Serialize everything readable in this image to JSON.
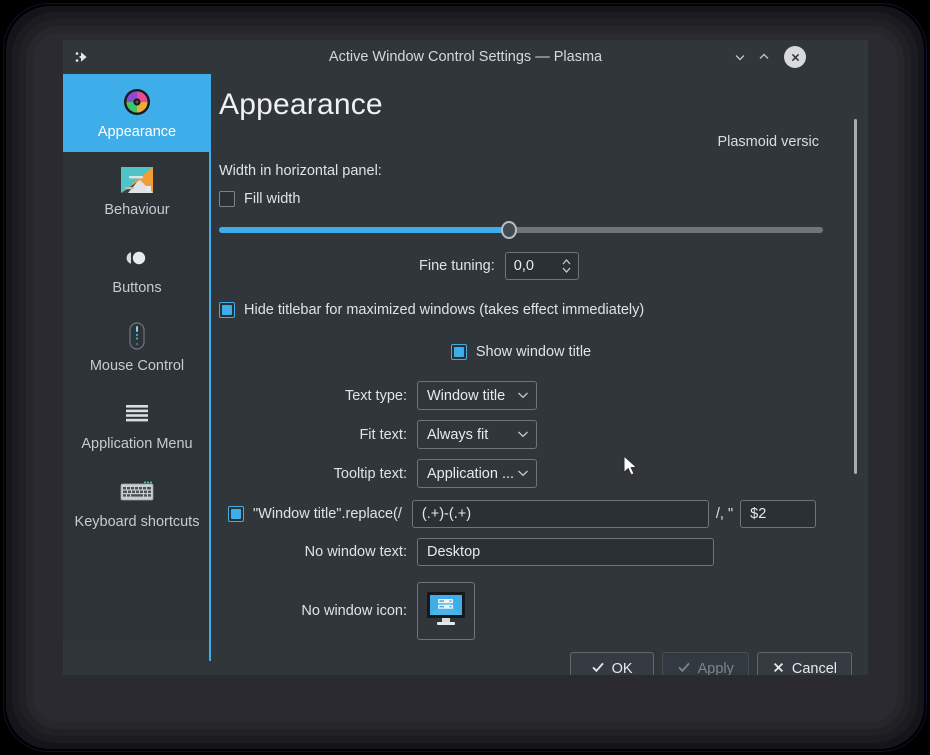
{
  "window": {
    "title": "Active Window Control Settings — Plasma",
    "app_icon": "plasma-dots-icon",
    "minimize_label": "Minimize",
    "maximize_label": "Maximize",
    "close_label": "Close"
  },
  "sidebar": {
    "items": [
      {
        "label": "Appearance",
        "icon": "color-wheel-icon",
        "active": true
      },
      {
        "label": "Behaviour",
        "icon": "desktop-behaviour-icon",
        "active": false
      },
      {
        "label": "Buttons",
        "icon": "window-buttons-icon",
        "active": false
      },
      {
        "label": "Mouse Control",
        "icon": "mouse-icon",
        "active": false
      },
      {
        "label": "Application Menu",
        "icon": "hamburger-menu-icon",
        "active": false
      },
      {
        "label": "Keyboard shortcuts",
        "icon": "keyboard-icon",
        "active": false
      }
    ]
  },
  "main": {
    "page_title": "Appearance",
    "plasmoid_version": "Plasmoid versic",
    "width_section_label": "Width in horizontal panel:",
    "fill_width": {
      "label": "Fill width",
      "checked": false
    },
    "slider": {
      "value": 48,
      "min": 0,
      "max": 100
    },
    "fine_tuning": {
      "label": "Fine tuning:",
      "value": "0,0"
    },
    "hide_titlebar": {
      "label": "Hide titlebar for maximized windows (takes effect immediately)",
      "checked": true
    },
    "show_window_title": {
      "label": "Show window title",
      "checked": true
    },
    "text_type": {
      "label": "Text type:",
      "value": "Window title"
    },
    "fit_text": {
      "label": "Fit text:",
      "value": "Always fit"
    },
    "tooltip_text": {
      "label": "Tooltip text:",
      "value": "Application ..."
    },
    "replace": {
      "checked": true,
      "label": "\"Window title\".replace(/",
      "pattern_value": "(.+)-(.+)",
      "separator": "/, \"",
      "replacement_value": "$2"
    },
    "no_window_text": {
      "label": "No window text:",
      "value": "Desktop"
    },
    "no_window_icon": {
      "label": "No window icon:",
      "icon": "monitor-desktop-icon"
    }
  },
  "footer": {
    "ok": {
      "label": "OK",
      "icon": "check-icon",
      "enabled": true
    },
    "apply": {
      "label": "Apply",
      "icon": "check-icon",
      "enabled": false
    },
    "cancel": {
      "label": "Cancel",
      "icon": "cross-icon",
      "enabled": true
    }
  },
  "colors": {
    "accent": "#3daee9",
    "window_bg": "#31363b",
    "sidebar_bg": "#2e3338",
    "text": "#e3e6e8"
  }
}
